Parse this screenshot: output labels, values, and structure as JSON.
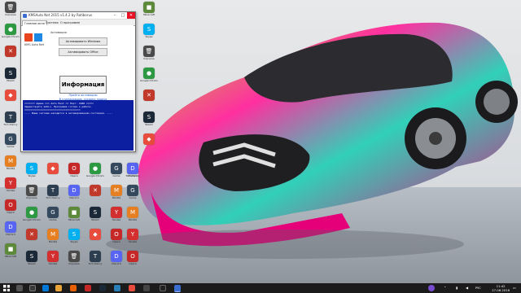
{
  "window": {
    "title": "KMSAuto Net 2015 v1.4.2 by Ratiborus",
    "tabs": [
      "Главное окно",
      "Система",
      "О программе"
    ],
    "logo_caption": "KMS Auto Net",
    "group_label": "Активация",
    "activate_windows_label": "Активировать Windows",
    "activate_office_label": "Активировать Office",
    "info_button_label": "Информация",
    "link_1": "Пройти активацию",
    "link_2": "В планировщик создана задача",
    "console_lines": [
      "======= Админ  === Auto Host == Порт: 1688 =====",
      "Здравствуйте admin. Программа готова к работе.",
      "======================================",
      "---- Ваша система находится в активированном состоянии. ----"
    ]
  },
  "desktop_icons": [
    {
      "label": "Корзина",
      "color": "#4a4a4a",
      "glyph": "🗑"
    },
    {
      "label": "Google Chrome",
      "color": "#2d9a43",
      "glyph": "●"
    },
    {
      "label": "",
      "color": "#c0392b",
      "glyph": "✕"
    },
    {
      "label": "Steam",
      "color": "#1b2838",
      "glyph": "S"
    },
    {
      "label": "",
      "color": "#e74c3c",
      "glyph": "◆"
    },
    {
      "label": "Tom Clancy",
      "color": "#2c3e50",
      "glyph": "T"
    },
    {
      "label": "Game",
      "color": "#34495e",
      "glyph": "G"
    },
    {
      "label": "Mozilla",
      "color": "#e67e22",
      "glyph": "M"
    },
    {
      "label": "Yandex",
      "color": "#d32f2f",
      "glyph": "Y"
    },
    {
      "label": "Opera",
      "color": "#c62828",
      "glyph": "O"
    },
    {
      "label": "Discord",
      "color": "#5865f2",
      "glyph": "D"
    },
    {
      "label": "Minecraft",
      "color": "#5d8a3a",
      "glyph": "■"
    },
    {
      "label": "Skype",
      "color": "#00aff0",
      "glyph": "S"
    }
  ],
  "taskbar": {
    "time": "11:42",
    "date": "27.06.2016",
    "lang": "РУС"
  }
}
